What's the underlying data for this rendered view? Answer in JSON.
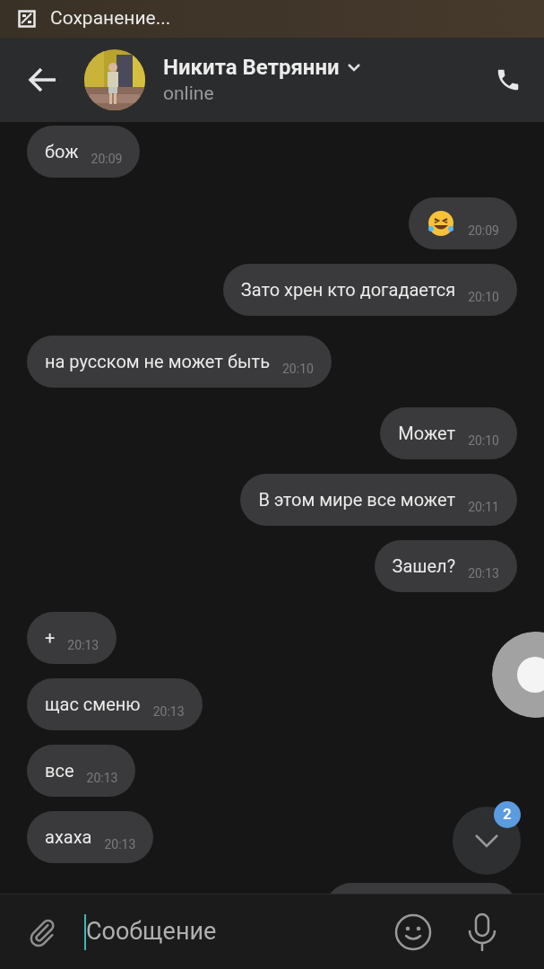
{
  "status_bar": {
    "text": "Сохранение..."
  },
  "header": {
    "name": "Никита Ветрянни",
    "status": "online"
  },
  "messages": [
    {
      "outgoing": false,
      "kind": "text",
      "text": "бож",
      "time": "20:09"
    },
    {
      "outgoing": true,
      "kind": "emoji",
      "time": "20:09"
    },
    {
      "outgoing": true,
      "kind": "text",
      "text": "Зато хрен кто догадается",
      "time": "20:10"
    },
    {
      "outgoing": false,
      "kind": "text",
      "text": "на русском не может быть",
      "time": "20:10"
    },
    {
      "outgoing": true,
      "kind": "text",
      "text": "Может",
      "time": "20:10"
    },
    {
      "outgoing": true,
      "kind": "text",
      "text": "В этом мире все может",
      "time": "20:11"
    },
    {
      "outgoing": true,
      "kind": "text",
      "text": "Зашел?",
      "time": "20:13"
    },
    {
      "outgoing": false,
      "kind": "text",
      "text": "+",
      "time": "20:13"
    },
    {
      "outgoing": false,
      "kind": "text",
      "text": "щас сменю",
      "time": "20:13"
    },
    {
      "outgoing": false,
      "kind": "text",
      "text": "все",
      "time": "20:13"
    },
    {
      "outgoing": false,
      "kind": "text",
      "text": "ахаха",
      "time": "20:13"
    },
    {
      "outgoing": true,
      "kind": "hidden"
    }
  ],
  "scroll_button": {
    "badge": "2"
  },
  "composer": {
    "placeholder": "Сообщение"
  }
}
